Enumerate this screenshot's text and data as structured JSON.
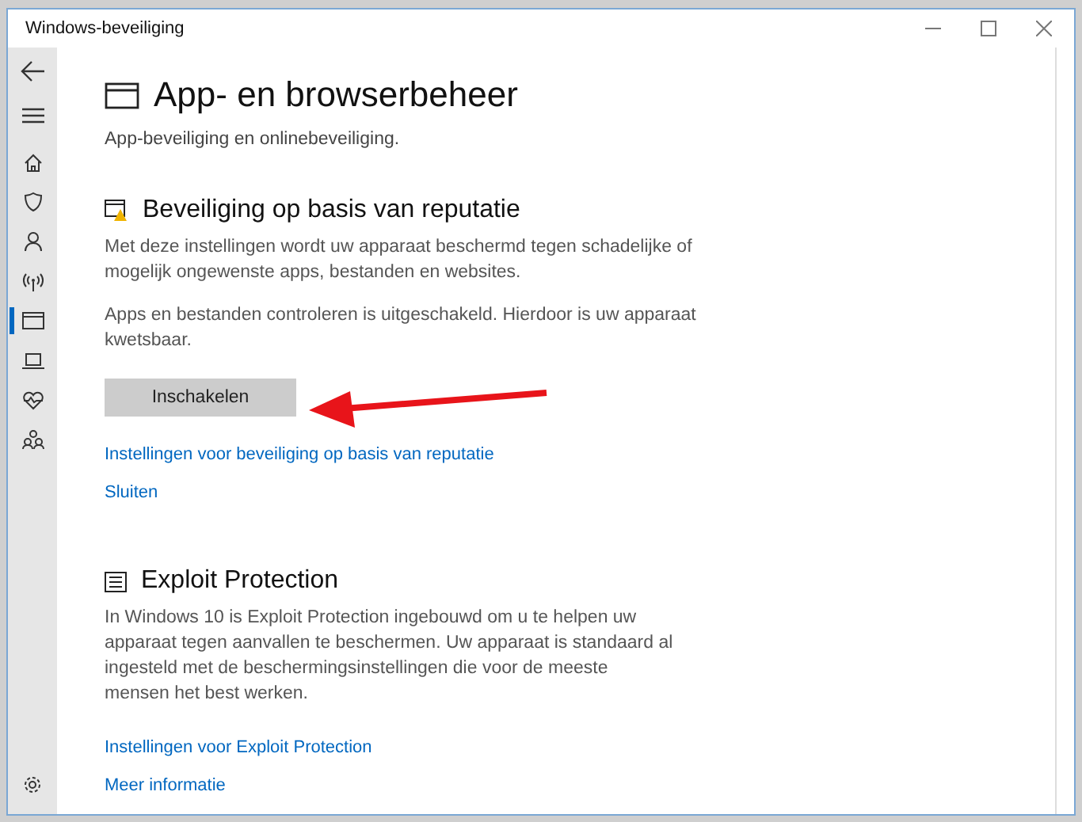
{
  "window": {
    "title": "Windows-beveiliging"
  },
  "nav_items": [
    {
      "selected": false
    },
    {
      "selected": false
    },
    {
      "selected": false
    },
    {
      "selected": false
    },
    {
      "selected": true
    },
    {
      "selected": false
    },
    {
      "selected": false
    },
    {
      "selected": false
    }
  ],
  "page": {
    "title": "App- en browserbeheer",
    "subtitle": "App-beveiliging en onlinebeveiliging."
  },
  "sections": [
    {
      "kind": "reputation",
      "title": "Beveiliging op basis van reputatie",
      "warning": true,
      "paragraphs": [
        "Met deze instellingen wordt uw apparaat beschermd tegen schadelijke of mogelijk ongewenste apps, bestanden en websites.",
        "Apps en bestanden controleren is uitgeschakeld. Hierdoor is uw apparaat kwetsbaar."
      ],
      "button": "Inschakelen",
      "links": [
        "Instellingen voor beveiliging op basis van reputatie",
        "Sluiten"
      ]
    },
    {
      "kind": "exploit",
      "title": "Exploit Protection",
      "warning": false,
      "paragraphs": [
        "In Windows 10 is Exploit Protection ingebouwd om u te helpen uw apparaat tegen aanvallen te beschermen.  Uw apparaat is standaard al ingesteld met de beschermingsinstellingen die voor de meeste mensen het best werken."
      ],
      "links": [
        "Instellingen voor Exploit Protection",
        "Meer informatie"
      ]
    }
  ]
}
